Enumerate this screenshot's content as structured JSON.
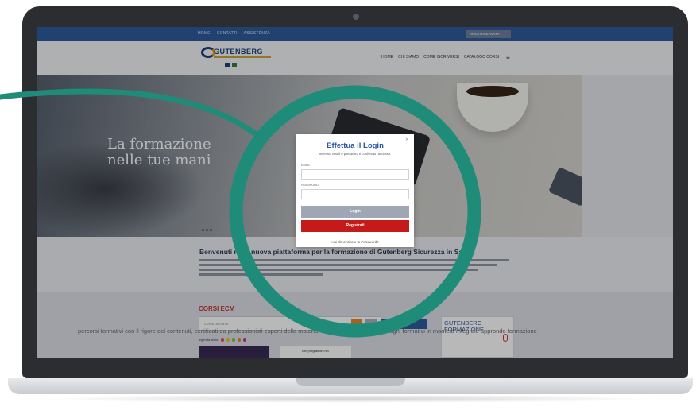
{
  "site": {
    "topnav": [
      "HOME",
      "CONTATTI",
      "ASSISTENZA"
    ],
    "area_button": "AREA RISERVATA",
    "logo_text": "GUTENBERG",
    "mainnav": [
      "HOME",
      "CHI SIAMO",
      "COME ISCRIVERSI",
      "CATALOGO CORSI"
    ],
    "hero_title": "La formazione nelle tue mani",
    "welcome_title": "Benvenuti nella nuova piattaforma per la formazione di Gutenberg Sicurezza in Sanità",
    "corsi_title": "CORSI ECM",
    "search_placeholder": "Cerca un corso",
    "legend_label": "legenda stato:",
    "promo_title": "GUTENBERG FORMAZIONE",
    "card_mid_text": "con programa/ERS",
    "bottom_text": "percorsi formativi con il rigore dei contenuti, certificati da professionisti esperti della materia. Gutenberg risponde ai bisogni formativi in maniera integrale approndo formazione"
  },
  "modal": {
    "title": "Effettua il Login",
    "subtitle": "Inserisci email e password e conferma l'accesso.",
    "email_label": "EMAIL",
    "password_label": "PASSWORD",
    "login_button": "Login",
    "register_button": "Registrati",
    "forgot_link": "Hai dimenticato la Password?",
    "close_symbol": "×"
  },
  "colors": {
    "topbar": "#2f5a9b",
    "accent_green": "#1e8c78",
    "login_gray": "#a0a7b4",
    "register_red": "#c41a1a",
    "title_blue": "#2a56a6"
  },
  "legend_colors": [
    "#e04b4b",
    "#e8c52a",
    "#7ac143",
    "#e88a2a",
    "#c03bb0"
  ]
}
